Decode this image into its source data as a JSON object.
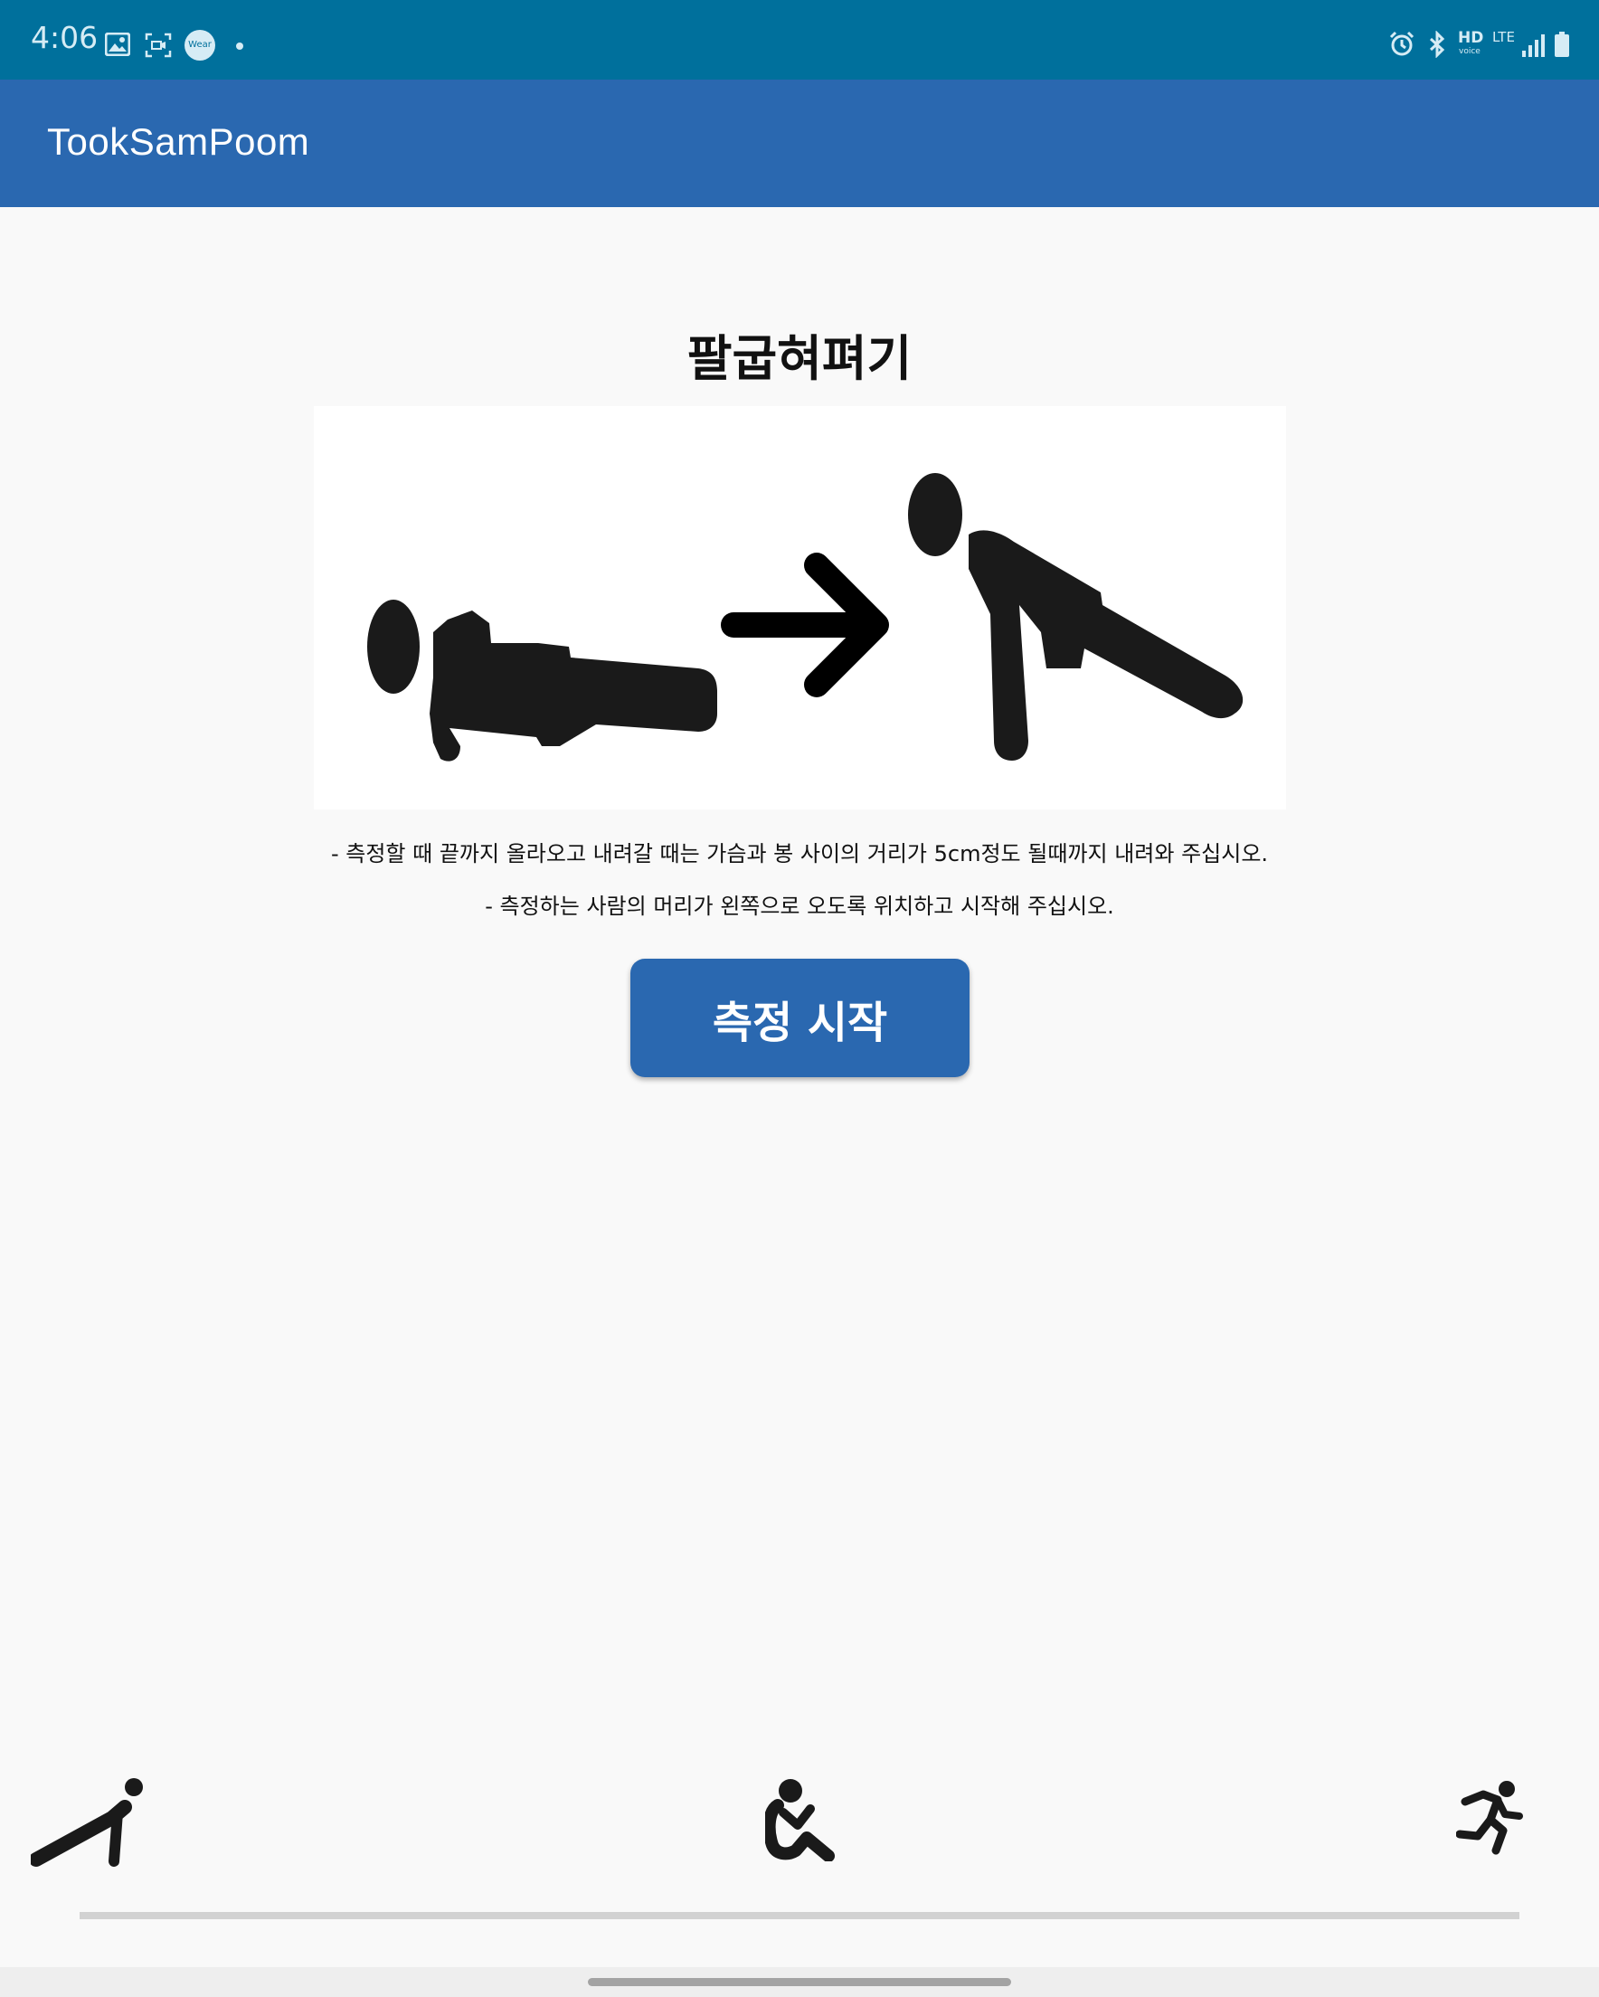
{
  "status_bar": {
    "time": "4:06",
    "wear_badge": "Wear",
    "hd_label": "HD",
    "voice_label": "voice",
    "lte_label": "LTE",
    "icons": [
      "gallery-icon",
      "screen-record-icon",
      "wear-icon",
      "notification-dot",
      "alarm-icon",
      "bluetooth-icon",
      "signal-icon",
      "battery-icon"
    ]
  },
  "app_bar": {
    "title": "TookSamPoom"
  },
  "main": {
    "exercise_title": "팔굽혀펴기",
    "illustration": "push-up-illustration",
    "instructions": [
      "- 측정할 때 끝까지 올라오고 내려갈 때는 가슴과 봉 사이의 거리가 5cm정도 될때까지 내려와 주십시오.",
      "- 측정하는 사람의 머리가 왼쪽으로 오도록 위치하고 시작해 주십시오."
    ],
    "start_button": "측정 시작"
  },
  "bottom_nav": {
    "items": [
      "push-up-icon",
      "sit-up-icon",
      "running-icon"
    ]
  },
  "colors": {
    "status_bar": "#00709c",
    "app_bar": "#2a68b0",
    "button": "#2a68b0",
    "background": "#f9f9f9"
  }
}
